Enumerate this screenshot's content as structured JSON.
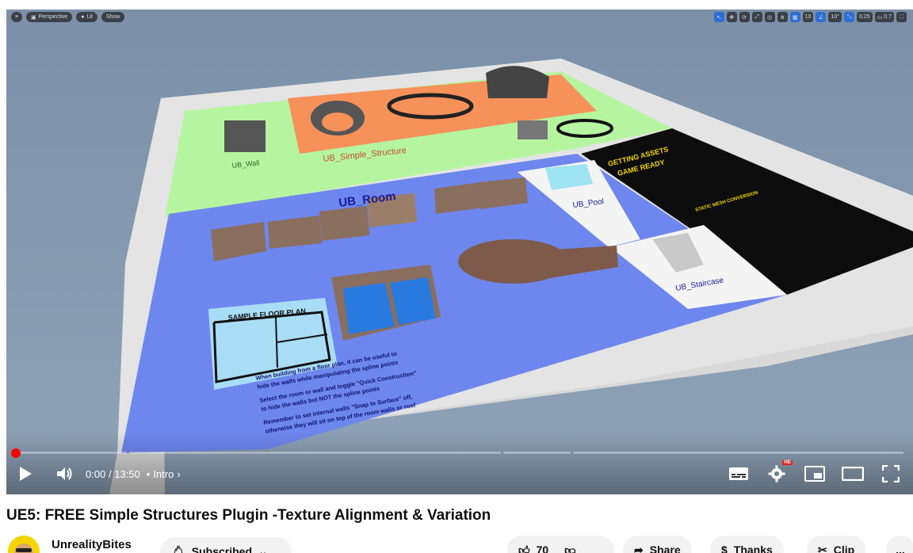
{
  "ue_toolbar": {
    "perspective_label": "Perspective",
    "lit_label": "Lit",
    "show_label": "Show",
    "grid_snap": "10",
    "angle_snap": "10°",
    "scale_snap": "0.25",
    "camera_speed": "0.7"
  },
  "scene_labels": {
    "room": "UB_Room",
    "sample_floor_plan": "SAMPLE FLOOR PLAN",
    "pool": "UB_Pool",
    "staircase": "UB_Staircase",
    "wall": "UB_Wall",
    "simple_structure": "UB_Simple_Structure",
    "getting_assets": "GETTING ASSETS",
    "game_ready": "GAME READY",
    "static_mesh": "STATIC MESH CONVERSION",
    "floorplan_note_1": "When building from a floor plan, it can be useful to",
    "floorplan_note_2": "hide the walls while manipulating the spline points",
    "floorplan_note_3": "Select the room or wall and toggle \"Quick Construction\"",
    "floorplan_note_4": "to hide the walls but NOT the spline points",
    "floorplan_note_5": "Remember to set internal walls \"Snap to Surface\" off,",
    "floorplan_note_6": "otherwise they will sit on top of the room walls or roof"
  },
  "player": {
    "time_current": "0:00",
    "time_separator": "/",
    "time_total": "13:50",
    "chapter_bullet": "•",
    "chapter": "Intro",
    "hd_badge": "HD",
    "progress_color": "#ff0000"
  },
  "video": {
    "title": "UE5: FREE Simple Structures Plugin -Texture Alignment & Variation",
    "channel": "UnrealityBites",
    "subscribe_label": "Subscribed",
    "likes": "70",
    "share_label": "Share",
    "thanks_label": "Thanks",
    "clip_label": "Clip",
    "more_label": "..."
  }
}
